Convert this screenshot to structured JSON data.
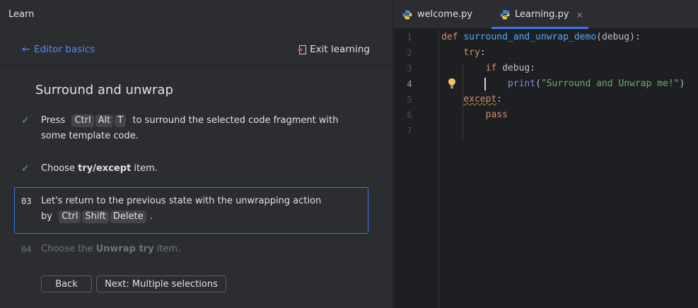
{
  "learn": {
    "panel_title": "Learn",
    "back_label": "Editor basics",
    "exit_label": "Exit learning",
    "lesson_title": "Surround and unwrap",
    "steps": [
      {
        "marker": "✓",
        "line1_pre": "Press",
        "keys": [
          "Ctrl",
          "Alt",
          "T"
        ],
        "line1_post": "to surround the selected code fragment with",
        "line2": "some template code."
      },
      {
        "marker": "✓",
        "pre": "Choose",
        "bold": "try/except",
        "post": "item."
      },
      {
        "marker": "03",
        "line1": "Let's return to the previous state with the unwrapping action",
        "line2_pre": "by",
        "keys": [
          "Ctrl",
          "Shift",
          "Delete"
        ],
        "line2_post": "."
      },
      {
        "marker": "04",
        "pre": "Choose the",
        "bold": "Unwrap try",
        "post": "item."
      }
    ],
    "back_button": "Back",
    "next_button": "Next: Multiple selections"
  },
  "editor": {
    "tabs": [
      {
        "label": "welcome.py",
        "active": false
      },
      {
        "label": "Learning.py",
        "active": true,
        "close": "×"
      }
    ],
    "line_numbers": [
      "1",
      "2",
      "3",
      "4",
      "5",
      "6",
      "7"
    ],
    "current_line": "4",
    "code": {
      "l1_kw": "def",
      "l1_fn": "surround_and_unwrap_demo",
      "l1_rest": "(debug):",
      "l2_kw": "try",
      "l2_rest": ":",
      "l3_kw": "if",
      "l3_rest": " debug:",
      "l4_fn": "print",
      "l4_open": "(",
      "l4_str": "\"Surround and Unwrap me!\"",
      "l4_close": ")",
      "l5_kw": "except",
      "l5_rest": ":",
      "l6_kw": "pass"
    }
  },
  "colors": {
    "accent": "#3574f0",
    "link": "#548af7",
    "check": "#5fb865",
    "keyword": "#cf8e6d",
    "function": "#56a8f5",
    "string": "#6aab73"
  },
  "icons": [
    "back-arrow-icon",
    "exit-icon",
    "check-icon",
    "python-file-icon",
    "close-icon",
    "lightbulb-icon"
  ]
}
